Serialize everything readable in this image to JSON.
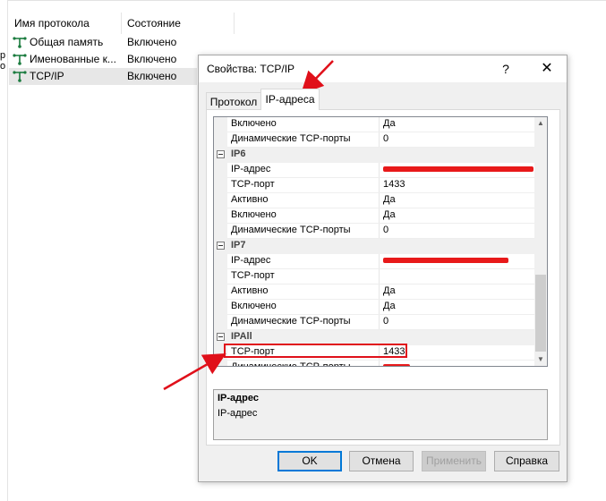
{
  "background": {
    "columns": [
      "Имя протокола",
      "Состояние"
    ],
    "protocols": [
      {
        "name": "Общая память",
        "state": "Включено"
      },
      {
        "name": "Именованные к...",
        "state": "Включено"
      },
      {
        "name": "TCP/IP",
        "state": "Включено"
      }
    ],
    "edge_fragments": [
      "р",
      "о"
    ]
  },
  "dialog": {
    "title": "Свойства: TCP/IP",
    "help_glyph": "?",
    "close_glyph": "✕",
    "tabs": [
      "Протокол",
      "IP-адреса"
    ],
    "active_tab": "IP-адреса",
    "rows": [
      {
        "kind": "prop",
        "key": "Включено",
        "value": "Да"
      },
      {
        "kind": "prop",
        "key": "Динамические TCP-порты",
        "value": "0"
      },
      {
        "kind": "cat",
        "name": "IP6"
      },
      {
        "kind": "prop",
        "key": "IP-адрес",
        "value": "",
        "redacted": true
      },
      {
        "kind": "prop",
        "key": "TCP-порт",
        "value": "1433"
      },
      {
        "kind": "prop",
        "key": "Активно",
        "value": "Да"
      },
      {
        "kind": "prop",
        "key": "Включено",
        "value": "Да"
      },
      {
        "kind": "prop",
        "key": "Динамические TCP-порты",
        "value": "0"
      },
      {
        "kind": "cat",
        "name": "IP7"
      },
      {
        "kind": "prop",
        "key": "IP-адрес",
        "value": "",
        "redacted": true
      },
      {
        "kind": "prop",
        "key": "TCP-порт",
        "value": ""
      },
      {
        "kind": "prop",
        "key": "Активно",
        "value": "Да"
      },
      {
        "kind": "prop",
        "key": "Включено",
        "value": "Да"
      },
      {
        "kind": "prop",
        "key": "Динамические TCP-порты",
        "value": "0"
      },
      {
        "kind": "cat",
        "name": "IPAll"
      },
      {
        "kind": "prop",
        "key": "TCP-порт",
        "value": "1433",
        "highlighted": true
      },
      {
        "kind": "prop",
        "key": "Динамические TCP-порты",
        "value": "",
        "redacted": true
      }
    ],
    "description": {
      "title": "IP-адрес",
      "text": "IP-адрес"
    },
    "buttons": {
      "ok": "OK",
      "cancel": "Отмена",
      "apply": "Применить",
      "help": "Справка"
    }
  },
  "colors": {
    "annotation_red": "#e0101a",
    "ok_focus": "#0078d7"
  }
}
